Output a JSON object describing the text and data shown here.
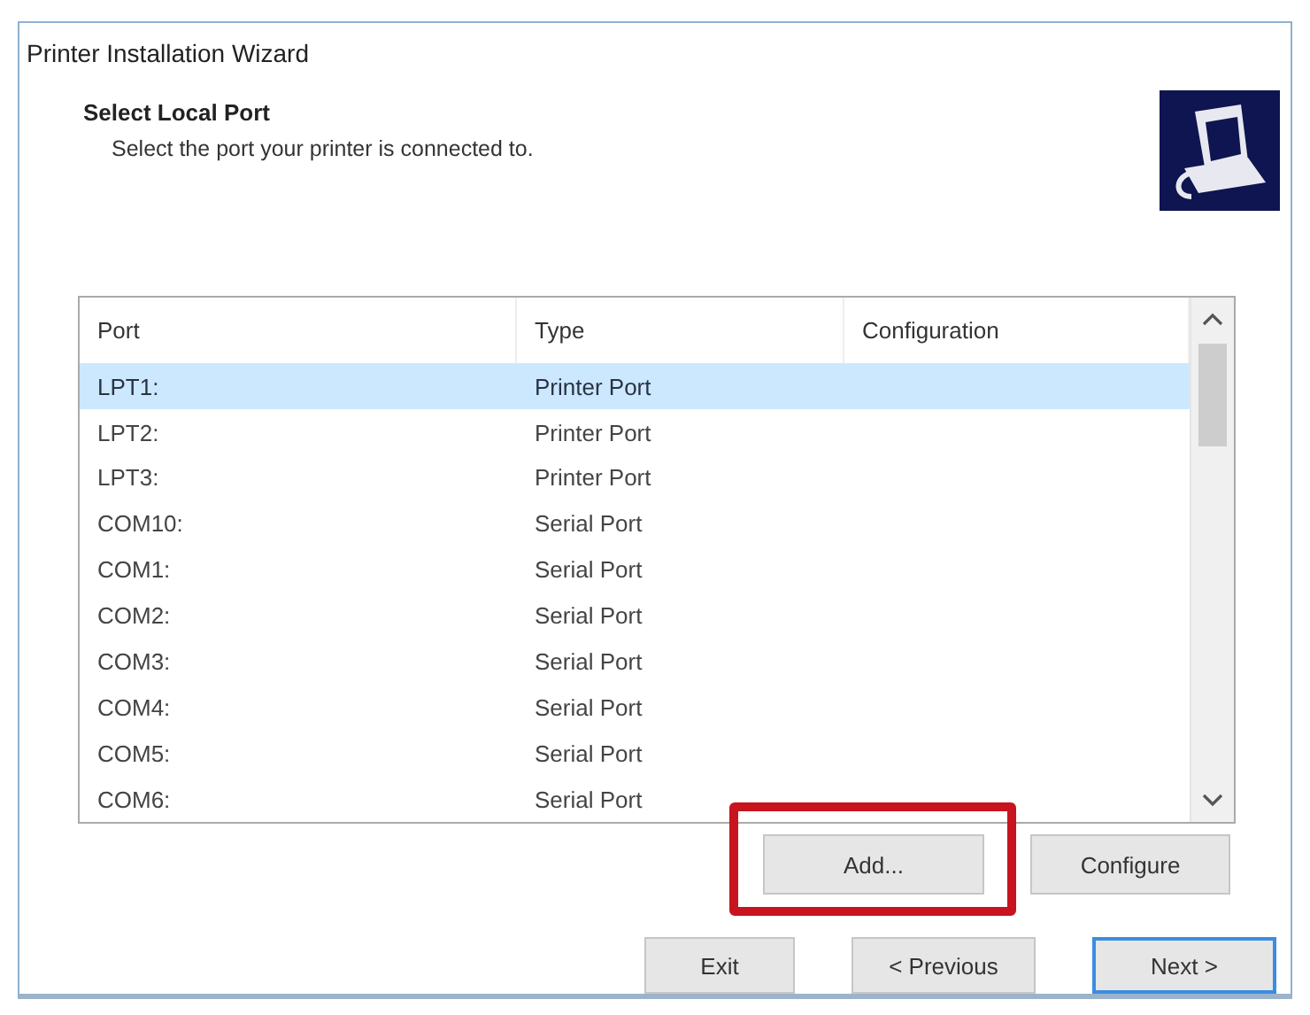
{
  "window": {
    "title": "Printer Installation Wizard"
  },
  "header": {
    "title": "Select Local Port",
    "subtitle": "Select the port your printer is connected to."
  },
  "port_list": {
    "columns": [
      "Port",
      "Type",
      "Configuration"
    ],
    "rows": [
      {
        "port": "LPT1:",
        "type": "Printer Port",
        "selected": true
      },
      {
        "port": "LPT2:",
        "type": "Printer Port",
        "selected": false
      },
      {
        "port": "LPT3:",
        "type": "Printer Port",
        "selected": false
      },
      {
        "port": "COM10:",
        "type": "Serial Port",
        "selected": false
      },
      {
        "port": "COM1:",
        "type": "Serial Port",
        "selected": false
      },
      {
        "port": "COM2:",
        "type": "Serial Port",
        "selected": false
      },
      {
        "port": "COM3:",
        "type": "Serial Port",
        "selected": false
      },
      {
        "port": "COM4:",
        "type": "Serial Port",
        "selected": false
      },
      {
        "port": "COM5:",
        "type": "Serial Port",
        "selected": false
      },
      {
        "port": "COM6:",
        "type": "Serial Port",
        "selected": false
      }
    ]
  },
  "list_buttons": [
    {
      "label": "Add...",
      "highlighted": true
    },
    {
      "label": "Configure",
      "highlighted": false
    }
  ],
  "nav_buttons": [
    {
      "label": "Exit",
      "focused": false
    },
    {
      "label": "< Previous",
      "focused": false
    },
    {
      "label": "Next >",
      "focused": true
    }
  ]
}
